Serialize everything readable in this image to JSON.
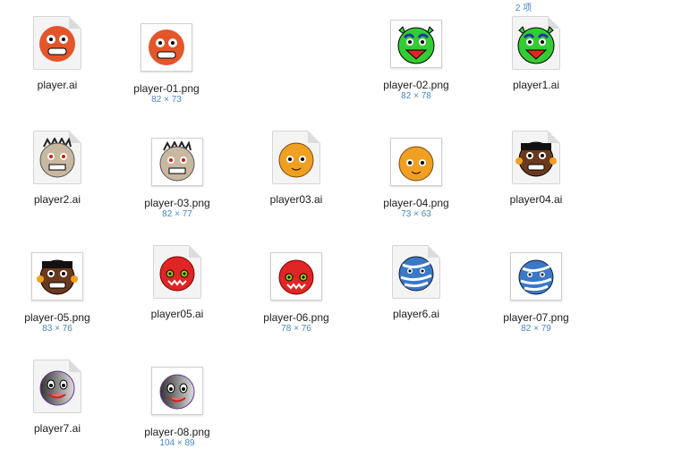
{
  "header": {
    "count_label": "2 项"
  },
  "files": [
    {
      "name": "player.ai",
      "dims": "",
      "kind": "ai",
      "face": "orange"
    },
    {
      "name": "player-01.png",
      "dims": "82 × 73",
      "kind": "png",
      "face": "orange"
    },
    {
      "name": "player-02.png",
      "dims": "82 × 78",
      "kind": "png",
      "face": "green"
    },
    {
      "name": "player1.ai",
      "dims": "",
      "kind": "ai",
      "face": "green"
    },
    {
      "name": "player2.ai",
      "dims": "",
      "kind": "ai",
      "face": "tan"
    },
    {
      "name": "player-03.png",
      "dims": "82 × 77",
      "kind": "png",
      "face": "tan"
    },
    {
      "name": "player03.ai",
      "dims": "",
      "kind": "ai",
      "face": "yellow"
    },
    {
      "name": "player-04.png",
      "dims": "73 × 63",
      "kind": "png",
      "face": "yellow"
    },
    {
      "name": "player04.ai",
      "dims": "",
      "kind": "ai",
      "face": "brown"
    },
    {
      "name": "player-05.png",
      "dims": "83 × 76",
      "kind": "png",
      "face": "brown"
    },
    {
      "name": "player05.ai",
      "dims": "",
      "kind": "ai",
      "face": "red"
    },
    {
      "name": "player-06.png",
      "dims": "78 × 76",
      "kind": "png",
      "face": "red"
    },
    {
      "name": "player6.ai",
      "dims": "",
      "kind": "ai",
      "face": "blue"
    },
    {
      "name": "player-07.png",
      "dims": "82 × 79",
      "kind": "png",
      "face": "blue"
    },
    {
      "name": "player7.ai",
      "dims": "",
      "kind": "ai",
      "face": "gray"
    },
    {
      "name": "player-08.png",
      "dims": "104 × 89",
      "kind": "png",
      "face": "gray"
    }
  ],
  "face_colors": {
    "orange": "#e2562a",
    "green": "#33cc33",
    "tan": "#c8b8a0",
    "yellow": "#f0a020",
    "brown": "#6b3a1e",
    "red": "#e02525",
    "blue": "#3a78c8",
    "gray": "#8a8a8a"
  },
  "accent_color": "#4a86c5"
}
